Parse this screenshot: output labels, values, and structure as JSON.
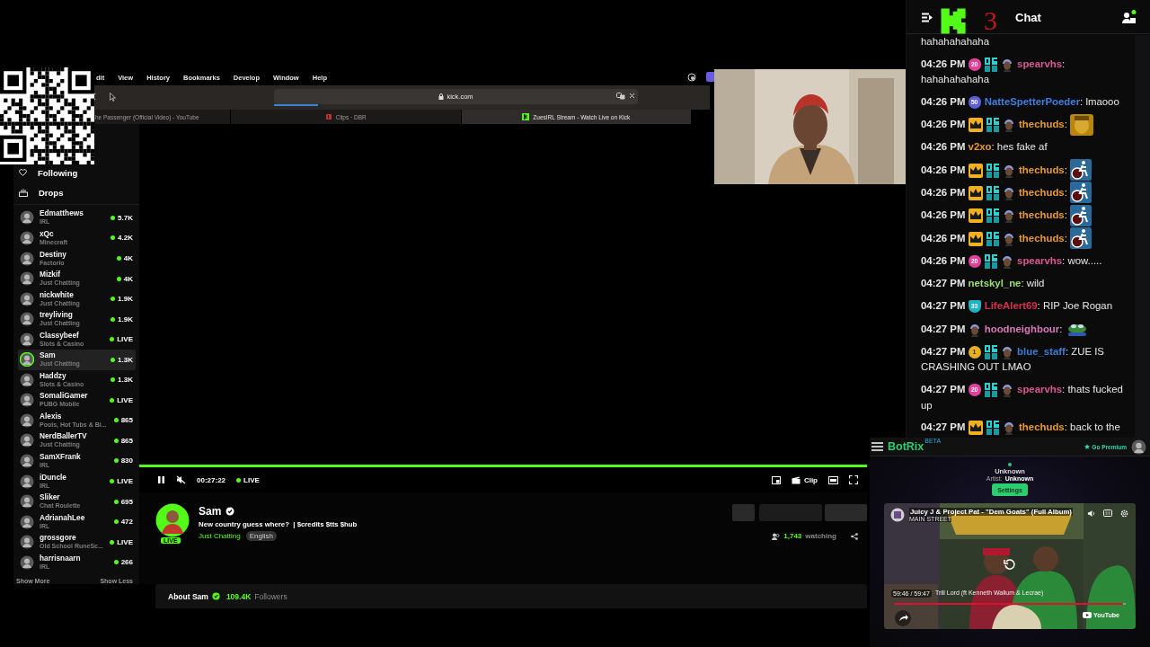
{
  "browser": {
    "menu": [
      "dit",
      "View",
      "History",
      "Bookmarks",
      "Develop",
      "Window",
      "Help"
    ],
    "address": "kick.com",
    "loading": {
      "level": 0.12
    },
    "tabs": [
      {
        "label": "he Passenger (Official Video) - YouTube",
        "kind": "plain",
        "selected": false
      },
      {
        "label": "Clips · DBR",
        "kind": "clips",
        "selected": false
      },
      {
        "label": "ZuesIRL Stream - Watch Live on Kick",
        "kind": "kick",
        "selected": true
      }
    ]
  },
  "sidebar": {
    "sections": [
      {
        "label": "Following",
        "kind": "following"
      },
      {
        "label": "Drops",
        "kind": "drops"
      }
    ],
    "channels": [
      {
        "name": "Edmatthews",
        "category": "IRL",
        "viewers": "5.7K",
        "selected": false
      },
      {
        "name": "xQc",
        "category": "Minecraft",
        "viewers": "4.2K",
        "selected": false
      },
      {
        "name": "Destiny",
        "category": "Factorio",
        "viewers": "4K",
        "selected": false
      },
      {
        "name": "Mizkif",
        "category": "Just Chatting",
        "viewers": "4K",
        "selected": false
      },
      {
        "name": "nickwhite",
        "category": "Just Chatting",
        "viewers": "1.9K",
        "selected": false
      },
      {
        "name": "treyliving",
        "category": "Just Chatting",
        "viewers": "1.9K",
        "selected": false
      },
      {
        "name": "Classybeef",
        "category": "Slots & Casino",
        "viewers": "LIVE",
        "selected": false
      },
      {
        "name": "Sam",
        "category": "Just Chatting",
        "viewers": "1.3K",
        "selected": true
      },
      {
        "name": "Haddzy",
        "category": "Slots & Casino",
        "viewers": "1.3K",
        "selected": false
      },
      {
        "name": "SomaliGamer",
        "category": "PUBG Mobile",
        "viewers": "LIVE",
        "selected": false
      },
      {
        "name": "Alexis",
        "category": "Pools, Hot Tubs & Bi...",
        "viewers": "865",
        "selected": false
      },
      {
        "name": "NerdBallerTV",
        "category": "Just Chatting",
        "viewers": "865",
        "selected": false
      },
      {
        "name": "SamXFrank",
        "category": "IRL",
        "viewers": "830",
        "selected": false
      },
      {
        "name": "iDuncle",
        "category": "IRL",
        "viewers": "LIVE",
        "selected": false
      },
      {
        "name": "Sliker",
        "category": "Chat Roulette",
        "viewers": "695",
        "selected": false
      },
      {
        "name": "AdrianahLee",
        "category": "IRL",
        "viewers": "472",
        "selected": false
      },
      {
        "name": "grossgore",
        "category": "Old School RuneSc...",
        "viewers": "LIVE",
        "selected": false
      },
      {
        "name": "harrisnaarn",
        "category": "IRL",
        "viewers": "266",
        "selected": false
      }
    ],
    "show_more": "Show More",
    "show_less": "Show Less"
  },
  "player": {
    "time": "00:27:22",
    "live": "LIVE",
    "clip": "Clip",
    "muted": true,
    "progress": {
      "level": 1
    }
  },
  "channel": {
    "name": "Sam",
    "avatar_badge": "LIVE",
    "title": "New country guess where?  | $credits $tts $hub",
    "category": "Just Chatting",
    "language": "English",
    "viewers": "1,743",
    "viewers_label": "watching",
    "about": "About Sam",
    "followers": "109.4K",
    "followers_label": "Followers"
  },
  "chat": {
    "title": "Chat",
    "overlay_digit": "3",
    "messages": [
      {
        "kind": "text",
        "text": "hahahahahaha"
      },
      {
        "kind": "text",
        "time": "04:26 PM",
        "badges": [
          {
            "kind": "sub",
            "text": "20",
            "color": "#e0409a"
          },
          {
            "kind": "og"
          },
          {
            "kind": "avatar"
          }
        ],
        "user": "spearvhs",
        "color": "#d9588f",
        "text": ": hahahahahaha"
      },
      {
        "kind": "text",
        "time": "04:26 PM",
        "badges": [
          {
            "kind": "sub",
            "text": "50",
            "color": "#5c5fd6"
          }
        ],
        "user": "NatteSpetterPoeder",
        "color": "#3f7fe0",
        "text": ": lmaooo"
      },
      {
        "kind": "face",
        "time": "04:26 PM",
        "badges": [
          {
            "kind": "crown"
          },
          {
            "kind": "og"
          },
          {
            "kind": "avatar"
          }
        ],
        "user": "thechuds",
        "color": "#e89a30",
        "text": ":"
      },
      {
        "kind": "text",
        "time": "04:26 PM",
        "user": "v2xo",
        "color": "#e89a30",
        "text": ": hes fake af"
      },
      {
        "kind": "wheelchair",
        "time": "04:26 PM",
        "badges": [
          {
            "kind": "crown"
          },
          {
            "kind": "og"
          },
          {
            "kind": "avatar"
          }
        ],
        "user": "thechuds",
        "color": "#e89a30",
        "text": ":"
      },
      {
        "kind": "wheelchair",
        "time": "04:26 PM",
        "badges": [
          {
            "kind": "crown"
          },
          {
            "kind": "og"
          },
          {
            "kind": "avatar"
          }
        ],
        "user": "thechuds",
        "color": "#e89a30",
        "text": ":"
      },
      {
        "kind": "wheelchair",
        "time": "04:26 PM",
        "badges": [
          {
            "kind": "crown"
          },
          {
            "kind": "og"
          },
          {
            "kind": "avatar"
          }
        ],
        "user": "thechuds",
        "color": "#e89a30",
        "text": ":"
      },
      {
        "kind": "wheelchair",
        "time": "04:26 PM",
        "badges": [
          {
            "kind": "crown"
          },
          {
            "kind": "og"
          },
          {
            "kind": "avatar"
          }
        ],
        "user": "thechuds",
        "color": "#e89a30",
        "text": ":"
      },
      {
        "kind": "text",
        "time": "04:26 PM",
        "badges": [
          {
            "kind": "sub",
            "text": "20",
            "color": "#e0409a"
          },
          {
            "kind": "og"
          },
          {
            "kind": "avatar"
          }
        ],
        "user": "spearvhs",
        "color": "#d9588f",
        "text": ": wow....."
      },
      {
        "kind": "text",
        "time": "04:27 PM",
        "user": "netskyl_ne",
        "color": "#9be070",
        "text": ": wild"
      },
      {
        "kind": "text",
        "time": "04:27 PM",
        "badges": [
          {
            "kind": "shield",
            "text": "33",
            "color": "#1fb3c4"
          }
        ],
        "user": "LifeAlert69",
        "color": "#d6304e",
        "text": ": RIP Joe Rogan"
      },
      {
        "kind": "frog",
        "time": "04:27 PM",
        "badges": [
          {
            "kind": "avatar"
          }
        ],
        "user": "hoodneighbour",
        "color": "#d878b8",
        "text": ":"
      },
      {
        "kind": "text",
        "time": "04:27 PM",
        "badges": [
          {
            "kind": "coin",
            "text": "1",
            "color": "#e8b020"
          },
          {
            "kind": "og"
          },
          {
            "kind": "avatar"
          }
        ],
        "user": "blue_staff",
        "color": "#3a7bd5",
        "text": ": ZUE IS CRASHING OUT LMAO"
      },
      {
        "kind": "text",
        "time": "04:27 PM",
        "badges": [
          {
            "kind": "sub",
            "text": "20",
            "color": "#e0409a"
          },
          {
            "kind": "og"
          },
          {
            "kind": "avatar"
          }
        ],
        "user": "spearvhs",
        "color": "#d9588f",
        "text": ": thats fucked up"
      },
      {
        "kind": "text",
        "time": "04:27 PM",
        "badges": [
          {
            "kind": "crown"
          },
          {
            "kind": "og"
          },
          {
            "kind": "avatar"
          }
        ],
        "user": "thechuds",
        "color": "#e89a30",
        "text": ": back to the"
      }
    ]
  },
  "botrix": {
    "brand": "BotRix",
    "beta": "BETA",
    "premium": "Go Premium",
    "track": "Unknown",
    "artist_label": "Artist:",
    "artist": "Unknown",
    "settings": "Settings",
    "video": {
      "title": "Juicy J & Project Pat - \"Dem Goats\" (Full Album)",
      "channel": "MAIN STREET",
      "time": "59:46 / 59:47",
      "chapter": "Trill Lord (ft Kenneth Wallum & Lecrae)",
      "progress": {
        "level": 0.99
      },
      "logo": "YouTube"
    }
  }
}
